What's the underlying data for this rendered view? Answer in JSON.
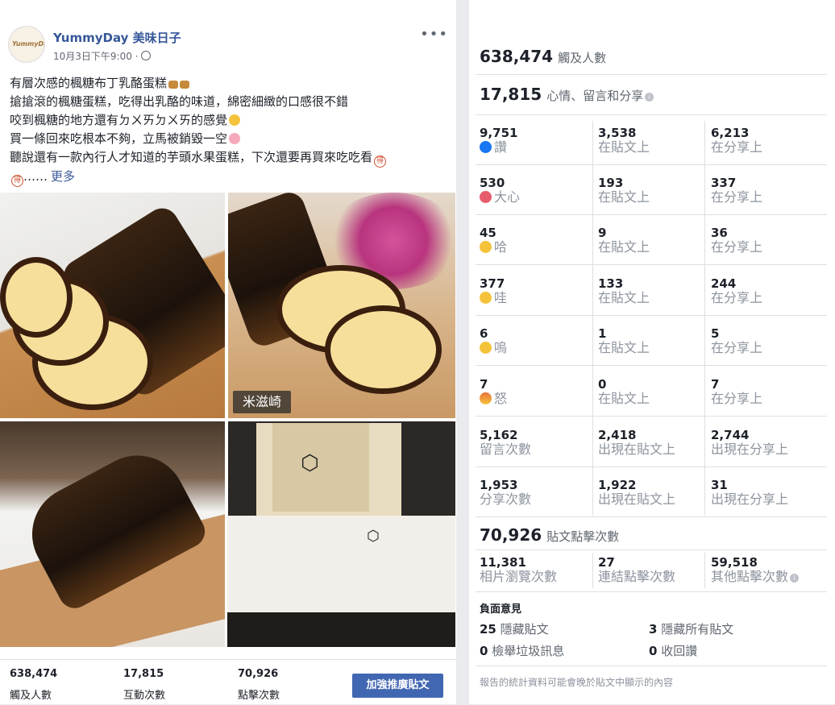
{
  "post": {
    "page_name": "YummyDay 美味日子",
    "date": "10月3日下午9:00 ·",
    "more_label": "•••",
    "avatar_text": "YummyDay",
    "text_lines": [
      "有層次感的楓糖布丁乳酪蛋糕",
      "搶搶滾的楓糖蛋糕，吃得出乳酪的味道，綿密細緻的口感很不錯",
      "咬到楓糖的地方還有ㄉㄨㄞㄉㄨㄞ的感覺",
      "買一條回來吃根本不夠，立馬被銷毀一空",
      "聽說還有一款內行人才知道的芋頭水果蛋糕，下次還要再買來吃吃看"
    ],
    "last_line_tail": "……",
    "see_more": "更多",
    "emoji_de": "得",
    "watermark": "米滋崎",
    "footer": [
      {
        "value": "638,474",
        "label": "觸及人數"
      },
      {
        "value": "17,815",
        "label": "互動次數"
      },
      {
        "value": "70,926",
        "label": "點擊次數"
      }
    ],
    "boost_label": "加強推廣貼文"
  },
  "insights": {
    "reach": {
      "value": "638,474",
      "label": "觸及人數"
    },
    "engagement": {
      "value": "17,815",
      "label": "心情、留言和分享"
    },
    "reactions": [
      {
        "icon": "like-icon",
        "label": "讚",
        "total": "9,751",
        "on_post": "3,538",
        "on_shares": "6,213"
      },
      {
        "icon": "love-icon",
        "label": "大心",
        "total": "530",
        "on_post": "193",
        "on_shares": "337"
      },
      {
        "icon": "haha-icon",
        "label": "哈",
        "total": "45",
        "on_post": "9",
        "on_shares": "36"
      },
      {
        "icon": "wow-icon",
        "label": "哇",
        "total": "377",
        "on_post": "133",
        "on_shares": "244"
      },
      {
        "icon": "sad-icon",
        "label": "嗚",
        "total": "6",
        "on_post": "1",
        "on_shares": "5"
      },
      {
        "icon": "angry-icon",
        "label": "怒",
        "total": "7",
        "on_post": "0",
        "on_shares": "7"
      }
    ],
    "on_post_label": "在貼文上",
    "on_shares_label": "在分享上",
    "comments": {
      "total": "5,162",
      "label": "留言次數",
      "on_post": "2,418",
      "on_post_label": "出現在貼文上",
      "on_shares": "2,744",
      "on_shares_label": "出現在分享上"
    },
    "shares": {
      "total": "1,953",
      "label": "分享次數",
      "on_post": "1,922",
      "on_post_label": "出現在貼文上",
      "on_shares": "31",
      "on_shares_label": "出現在分享上"
    },
    "clicks": {
      "value": "70,926",
      "label": "貼文點擊次數"
    },
    "click_breakdown": [
      {
        "value": "11,381",
        "label": "相片瀏覽次數"
      },
      {
        "value": "27",
        "label": "連結點擊次數"
      },
      {
        "value": "59,518",
        "label": "其他點擊次數"
      }
    ],
    "negative_title": "負面意見",
    "negative": [
      {
        "value": "25",
        "label": "隱藏貼文"
      },
      {
        "value": "3",
        "label": "隱藏所有貼文"
      },
      {
        "value": "0",
        "label": "檢舉垃圾訊息"
      },
      {
        "value": "0",
        "label": "收回讚"
      }
    ],
    "note": "報告的統計資料可能會晚於貼文中顯示的內容",
    "info_glyph": "i"
  }
}
